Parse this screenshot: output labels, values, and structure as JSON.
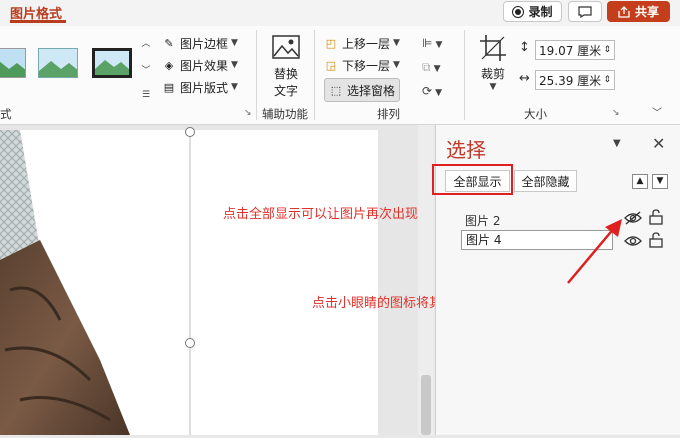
{
  "ribbon_tab": "图片格式",
  "top_buttons": {
    "record": "录制",
    "share": "共享"
  },
  "ribbon": {
    "styles_group_label_fragment": "式",
    "style_commands": [
      "图片边框",
      "图片效果",
      "图片版式"
    ],
    "alt_text_button": [
      "替换",
      "文字"
    ],
    "accessibility_label": "辅助功能",
    "arrange_commands": [
      "上移一层",
      "下移一层",
      "选择窗格"
    ],
    "arrange_label": "排列",
    "crop_label": "裁剪",
    "height_value": "19.07 厘米",
    "width_value": "25.39 厘米",
    "size_label": "大小"
  },
  "selection_pane": {
    "title": "选择",
    "show_all": "全部显示",
    "hide_all": "全部隐藏",
    "items": [
      {
        "name": "图片 2",
        "visible": false,
        "icon": "eye-off-icon"
      },
      {
        "name": "图片 4",
        "visible": true,
        "icon": "eye-icon"
      }
    ]
  },
  "annotations": {
    "show_all_tip": "点击全部显示可以让图片再次出现",
    "eye_tip": "点击小眼睛的图标将其打开，可以让图片再次出现"
  },
  "colors": {
    "accent": "#b83c1e",
    "share_bg": "#c43e1c",
    "annotation": "#e0312a",
    "callout_box": "#e02020"
  }
}
